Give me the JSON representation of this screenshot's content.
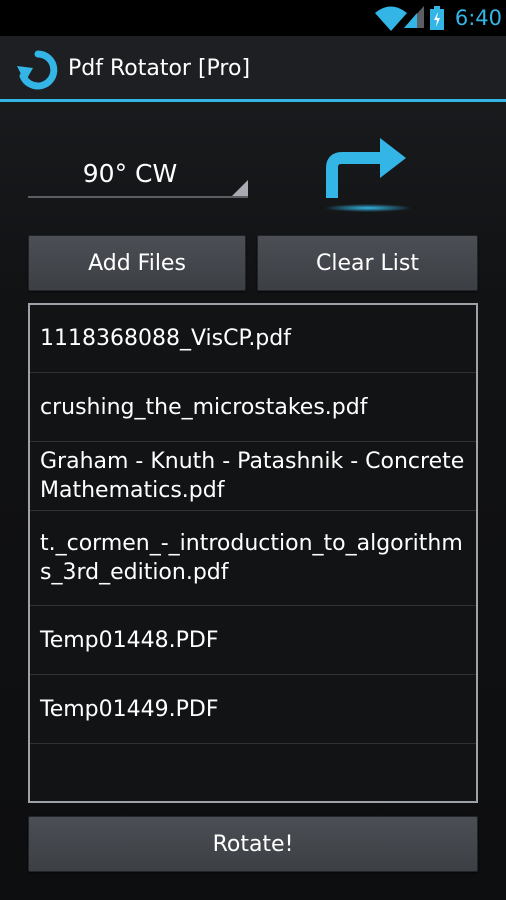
{
  "status_bar": {
    "time": "6:40",
    "wifi_icon": "wifi-icon",
    "signal_icon": "cell-signal-icon",
    "battery_icon": "battery-charging-icon",
    "accent_color": "#33b5e5"
  },
  "action_bar": {
    "title": "Pdf Rotator [Pro]",
    "icon": "rotate-app-icon"
  },
  "rotation": {
    "selected": "90° CW",
    "direction_icon": "turn-right-arrow-icon"
  },
  "buttons": {
    "add_files": "Add Files",
    "clear_list": "Clear List",
    "rotate": "Rotate!"
  },
  "files": [
    "1118368088_VisCP.pdf",
    "crushing_the_microstakes.pdf",
    "Graham - Knuth - Patashnik - Concrete Mathematics.pdf",
    "t._cormen_-_introduction_to_algorithms_3rd_edition.pdf",
    "Temp01448.PDF",
    "Temp01449.PDF"
  ]
}
